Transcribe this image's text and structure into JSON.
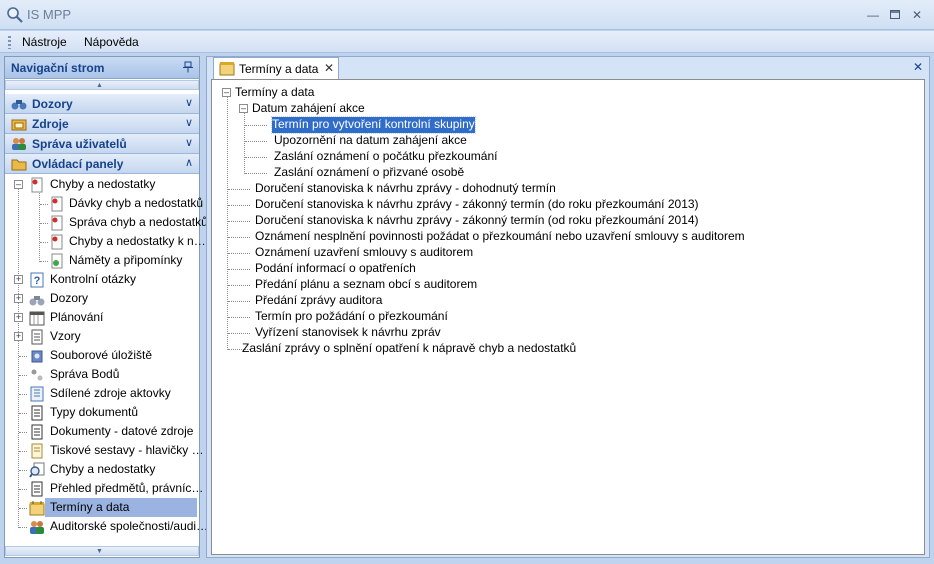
{
  "window": {
    "title": "IS MPP"
  },
  "menu": {
    "tools": "Nástroje",
    "help": "Nápověda"
  },
  "nav": {
    "header": "Navigační strom",
    "groups": [
      {
        "label": "Dozory",
        "icon": "binoculars-icon"
      },
      {
        "label": "Zdroje",
        "icon": "resources-icon"
      },
      {
        "label": "Správa uživatelů",
        "icon": "users-icon"
      },
      {
        "label": "Ovládací panely",
        "icon": "folder-icon"
      }
    ],
    "tree": [
      {
        "label": "Chyby a nedostatky",
        "icon": "error-doc-icon"
      },
      {
        "label": "Dávky chyb a nedostatků",
        "icon": "error-doc-icon"
      },
      {
        "label": "Správa chyb a nedostatků",
        "icon": "error-doc-icon"
      },
      {
        "label": "Chyby a nedostatky k n…",
        "icon": "error-doc-icon"
      },
      {
        "label": "Náměty a připomínky",
        "icon": "note-icon"
      },
      {
        "label": "Kontrolní otázky",
        "icon": "question-icon"
      },
      {
        "label": "Dozory",
        "icon": "binoculars-icon"
      },
      {
        "label": "Plánování",
        "icon": "calendar-icon"
      },
      {
        "label": "Vzory",
        "icon": "template-icon"
      },
      {
        "label": "Souborové úložiště",
        "icon": "storage-icon"
      },
      {
        "label": "Správa Bodů",
        "icon": "points-icon"
      },
      {
        "label": "Sdílené zdroje aktovky",
        "icon": "shared-icon"
      },
      {
        "label": "Typy dokumentů",
        "icon": "document-icon"
      },
      {
        "label": "Dokumenty - datové zdroje",
        "icon": "document-icon"
      },
      {
        "label": "Tiskové sestavy - hlavičky …",
        "icon": "report-icon"
      },
      {
        "label": "Chyby a nedostatky",
        "icon": "magnifier-doc-icon"
      },
      {
        "label": "Přehled předmětů, právníc…",
        "icon": "document-icon"
      },
      {
        "label": "Termíny a data",
        "icon": "calendar-icon"
      },
      {
        "label": "Auditorské společnosti/audi…",
        "icon": "people-icon"
      }
    ]
  },
  "content": {
    "tab_label": "Termíny a data",
    "root": "Termíny a data",
    "datum_node": "Datum zahájení akce",
    "datum_children": [
      "Termín pro vytvoření kontrolní skupiny",
      "Upozornění na datum zahájení akce",
      "Zaslání oznámení o počátku přezkoumání",
      "Zaslání oznámení o přizvané osobě"
    ],
    "items": [
      "Doručení stanoviska k návrhu zprávy - dohodnutý termín",
      "Doručení stanoviska k návrhu zprávy - zákonný termín (do roku přezkoumání 2013)",
      "Doručení stanoviska k návrhu zprávy - zákonný termín (od roku přezkoumání 2014)",
      "Oznámení nesplnění povinnosti požádat o přezkoumání nebo uzavření smlouvy s auditorem",
      "Oznámení uzavření smlouvy s auditorem",
      "Podání informací o opatřeních",
      "Předání plánu a seznam obcí s auditorem",
      "Předání zprávy auditora",
      "Termín pro požádání o přezkoumání",
      "Vyřízení stanovisek k návrhu zpráv",
      "Zaslání zprávy o splnění opatření k nápravě chyb a nedostatků"
    ]
  }
}
